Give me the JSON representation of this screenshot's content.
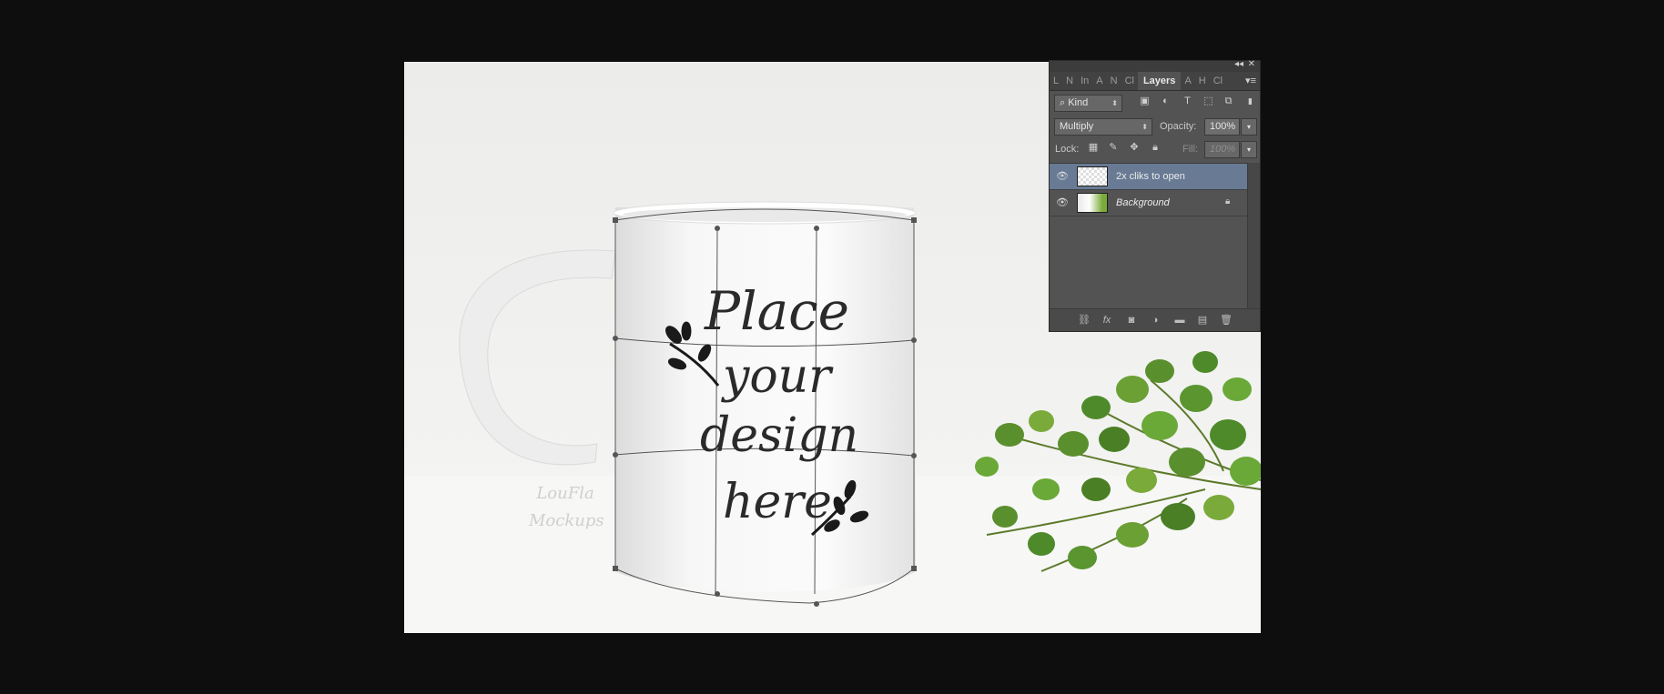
{
  "canvas": {
    "mug_text": {
      "line1": "Place",
      "line2": "your",
      "line3": "design",
      "line4": "here"
    },
    "watermark": {
      "line1": "LouFla",
      "line2": "Mockups"
    }
  },
  "layers_panel": {
    "top_controls": {
      "collapse_label": "◂◂",
      "close_label": "✕"
    },
    "tabs": [
      "L",
      "N",
      "In",
      "A",
      "N",
      "Cl",
      "Layers",
      "A",
      "H",
      "Cl"
    ],
    "active_tab": "Layers",
    "panel_menu_label": "▾≡",
    "filter": {
      "kind_label": "Kind"
    },
    "blend_mode": "Multiply",
    "opacity": {
      "label": "Opacity:",
      "value": "100%"
    },
    "lock": {
      "label": "Lock:"
    },
    "fill": {
      "label": "Fill:",
      "value": "100%"
    },
    "layers": [
      {
        "name": "2x cliks to open",
        "selected": true,
        "italic": false
      },
      {
        "name": "Background",
        "selected": false,
        "italic": true,
        "locked": true
      }
    ]
  },
  "colors": {
    "app_background": "#0e0e0e",
    "panel_background": "#535353",
    "selected_layer": "#687a94",
    "plant_green": "#5a8f2e"
  }
}
